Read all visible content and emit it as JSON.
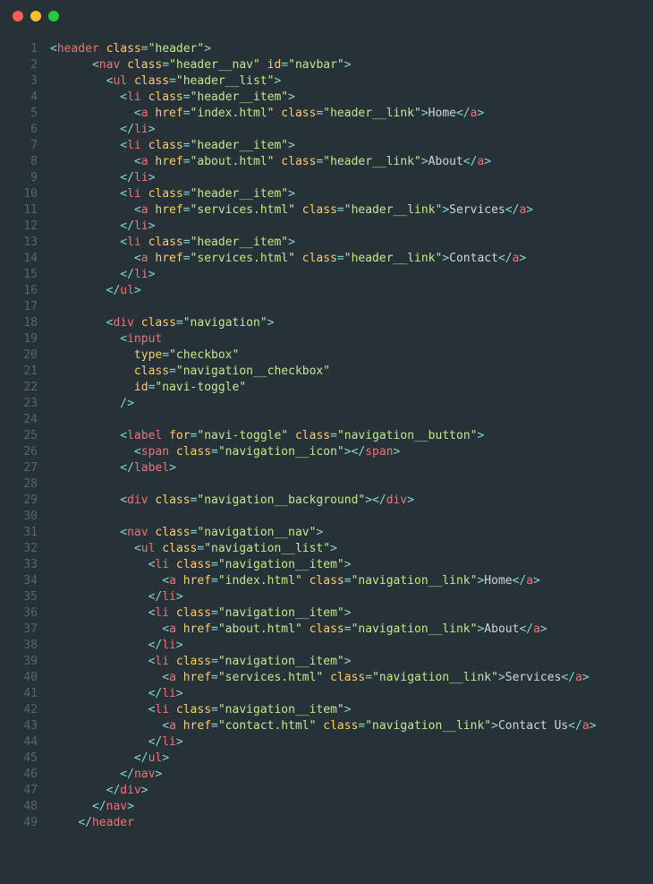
{
  "titlebar": {
    "dots": [
      "red",
      "yellow",
      "green"
    ]
  },
  "line_count": 49,
  "tokens": {
    "header": "header",
    "nav": "nav",
    "ul": "ul",
    "li": "li",
    "a": "a",
    "div": "div",
    "input": "input",
    "label": "label",
    "span": "span",
    "class": "class",
    "id": "id",
    "href": "href",
    "for": "for",
    "type": "type",
    "eq": "=",
    "lt": "<",
    "gt": ">",
    "lts": "</",
    "sgt": "/>",
    "cls_header": "\"header\"",
    "cls_header_nav": "\"header__nav\"",
    "id_navbar": "\"navbar\"",
    "cls_header_list": "\"header__list\"",
    "cls_header_item": "\"header__item\"",
    "cls_header_link": "\"header__link\"",
    "cls_navigation": "\"navigation\"",
    "val_checkbox": "\"checkbox\"",
    "cls_navigation_checkbox": "\"navigation__checkbox\"",
    "id_navi_toggle": "\"navi-toggle\"",
    "cls_navigation_button": "\"navigation__button\"",
    "cls_navigation_icon": "\"navigation__icon\"",
    "cls_navigation_background": "\"navigation__background\"",
    "cls_navigation_nav": "\"navigation__nav\"",
    "cls_navigation_list": "\"navigation__list\"",
    "cls_navigation_item": "\"navigation__item\"",
    "cls_navigation_link": "\"navigation__link\"",
    "href_index": "\"index.html\"",
    "href_about": "\"about.html\"",
    "href_services": "\"services.html\"",
    "href_contact": "\"contact.html\"",
    "txt_home": "Home",
    "txt_about": "About",
    "txt_services": "Services",
    "txt_contact": "Contact",
    "txt_contact_us": "Contact Us"
  }
}
